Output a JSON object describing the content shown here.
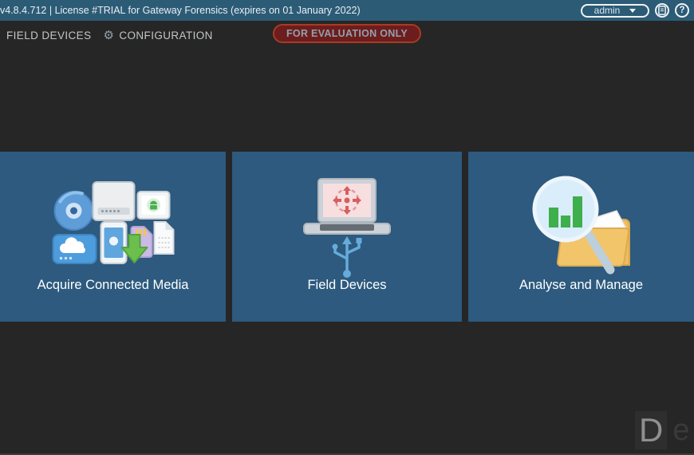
{
  "topbar": {
    "license_text": "v4.8.4.712 | License #TRIAL for Gateway Forensics (expires on 01 January 2022)",
    "user_label": "admin",
    "help_label": "?"
  },
  "nav": {
    "field_devices_tab": "FIELD DEVICES",
    "configuration_tab": "CONFIGURATION",
    "evaluation_badge": "FOR EVALUATION ONLY"
  },
  "cards": [
    {
      "title": "Acquire Connected Media"
    },
    {
      "title": "Field Devices"
    },
    {
      "title": "Analyse and Manage"
    }
  ],
  "watermark": {
    "lead": "D",
    "rest": "et"
  },
  "icons": {
    "gear": "⚙",
    "chevron_down": "chevron-down-icon",
    "notes": "notes-icon",
    "help": "help-icon"
  },
  "colors": {
    "topbar": "#2c5b76",
    "card": "#2d5a7e",
    "background": "#262626",
    "badge_bg": "#6d1d1d",
    "badge_border": "#a63c24",
    "arrow_green": "#6cbf4d",
    "usb_blue": "#66abdb",
    "chart_green": "#3fae4c",
    "folder_tan": "#eebc5f"
  }
}
